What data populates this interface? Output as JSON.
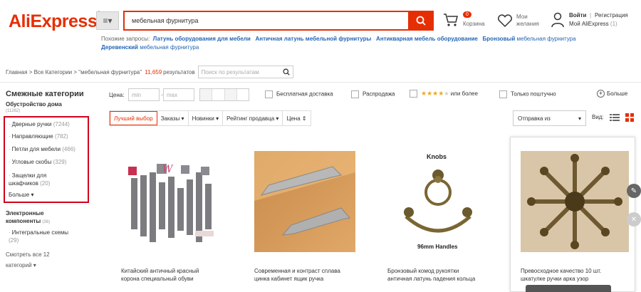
{
  "header": {
    "logo": "AliExpress",
    "logo_mark": "®",
    "search_value": "мебельная фурнитура",
    "cart_count": "0",
    "cart_label": "Корзина",
    "wish_label_1": "Мои",
    "wish_label_2": "желания",
    "login": "Войти",
    "register": "Регистрация",
    "my_account": "Мой AliExpress",
    "my_account_count": "(1)"
  },
  "related": {
    "label": "Похожие запросы:",
    "items": [
      {
        "bold": "Латунь оборудования для мебели",
        "rest": ""
      },
      {
        "bold": "Античная латунь мебельной фурнитуры",
        "rest": ""
      },
      {
        "bold": "Антикварная мебель оборудование",
        "rest": ""
      },
      {
        "bold": "Бронзовый",
        "rest": " мебельная фурнитура"
      },
      {
        "bold": "Деревенский",
        "rest": " мебельная фурнитура"
      }
    ]
  },
  "breadcrumb": {
    "home": "Главная",
    "sep": ">",
    "all": "Все Категории",
    "query": "\"мебельная фурнитура\"",
    "count": "11,659",
    "results": "результатов",
    "search_placeholder": "Поиск по результатам"
  },
  "sidebar": {
    "title": "Смежные категории",
    "group1": "Обустройство дома",
    "group1_count": "(11262)",
    "items": [
      {
        "label": "Дверные ручки",
        "count": "(7244)"
      },
      {
        "label": "Направляющие",
        "count": "(782)"
      },
      {
        "label": "Петли для мебели",
        "count": "(466)"
      },
      {
        "label": "Угловые скобы",
        "count": "(329)"
      },
      {
        "label": "Защелки для",
        "label2": "шкафчиков",
        "count": "(20)"
      }
    ],
    "more": "Больше ▾",
    "group2_1": "Электронные",
    "group2_2": "компоненты",
    "group2_count": "(36)",
    "item2_1": "Интегральные схемы",
    "item2_count": "(29)",
    "see_all_1": "Смотреть все 12",
    "see_all_2": "категорий ▾"
  },
  "filters": {
    "price": "Цена:",
    "min": "min",
    "dash": "-",
    "max": "max",
    "free_shipping": "Бесплатная доставка",
    "sale": "Распродажа",
    "or_more": "или более",
    "ordered_only": "Только поштучно",
    "more": "Больше"
  },
  "sort": {
    "items": [
      "Лучший выбор",
      "Заказы ▾",
      "Новинки ▾",
      "Рейтинг продавца ▾",
      "Цена ⇕"
    ],
    "ship_from": "Отправка из",
    "view": "Вид:"
  },
  "products": [
    {
      "title1": "Китайский античный красный",
      "title2": "корона специальный обуви",
      "img_text": ""
    },
    {
      "title1": "Современная и контраст сплава",
      "title2": "цинка кабинет ящик ручка",
      "img_text": ""
    },
    {
      "title1": "Бронзовый комод рукоятки",
      "title2": "античная латунь падения кольца",
      "img_top": "Knobs",
      "img_bottom": "96mm Handles"
    },
    {
      "title1": "Превосходное качество 10 шт.",
      "title2": "шкатулке ручки арка узор",
      "img_text": ""
    }
  ],
  "colors": {
    "accent": "#e62e04",
    "link": "#2466b5",
    "highlight_box": "#d0021b"
  }
}
